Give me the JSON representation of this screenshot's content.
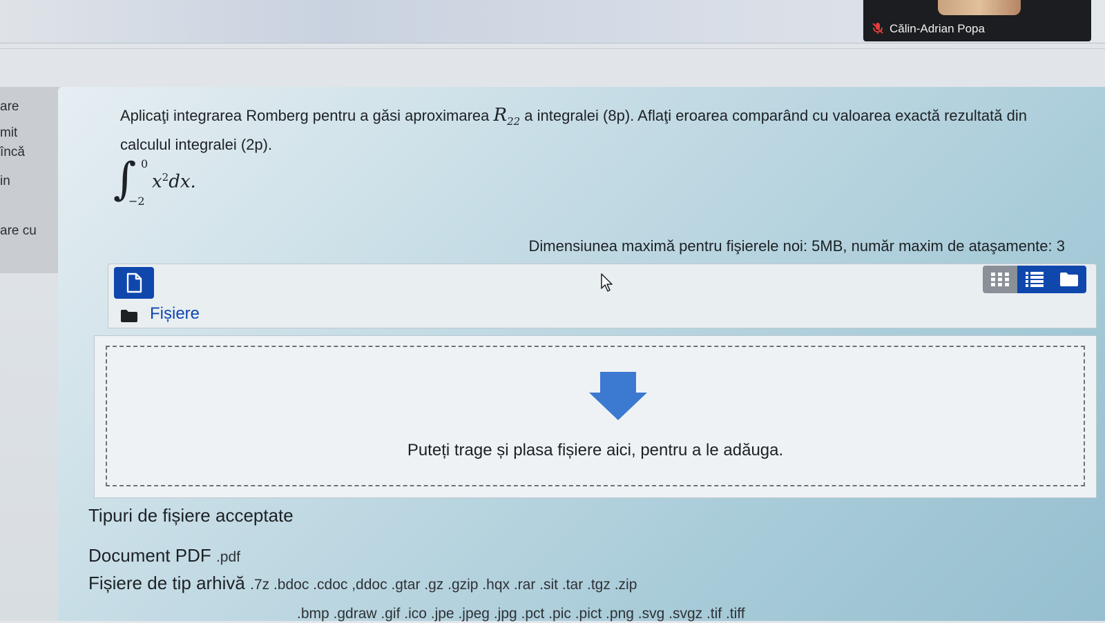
{
  "zoom": {
    "participant_name": "Călin-Adrian Popa",
    "mic_icon": "mic-muted-icon"
  },
  "left_nav": {
    "fragments": [
      "are",
      "mit",
      "încă",
      "in",
      "are cu"
    ]
  },
  "question": {
    "text_part1": "Aplicaţi integrarea Romberg pentru a găsi aproximarea ",
    "symbol": "R",
    "symbol_sub": "22",
    "text_part2": " a integralei (8p). Aflaţi eroarea comparând cu valoarea exactă rezultată din calculul integralei (2p).",
    "integral_upper": "0",
    "integral_lower": "−2",
    "integral_body": "x",
    "integral_power": "2",
    "integral_tail": "dx."
  },
  "filepicker": {
    "max_size_note": "Dimensiunea maximă pentru fişierele noi: 5MB, număr maxim de ataşamente: 3",
    "folder_label": "Fișiere",
    "drop_text": "Puteți trage și plasa fișiere aici, pentru a le adăuga.",
    "view_buttons": [
      "icons-view",
      "list-view",
      "tree-view"
    ]
  },
  "accepted_types": {
    "heading": "Tipuri de fișiere acceptate",
    "rows": [
      {
        "label": "Document PDF",
        "ext": ".pdf"
      },
      {
        "label": "Fișiere de tip arhivă",
        "ext": ".7z .bdoc .cdoc ,ddoc .gtar .gz .gzip .hqx .rar .sit .tar .tgz .zip"
      },
      {
        "label": "",
        "ext": ".bmp .gdraw .gif .ico .jpe .jpeg .jpg .pct .pic .pict .png .svg .svgz .tif .tiff"
      }
    ]
  },
  "colors": {
    "primary_blue": "#0f47ad",
    "drop_arrow": "#3c79d0"
  }
}
